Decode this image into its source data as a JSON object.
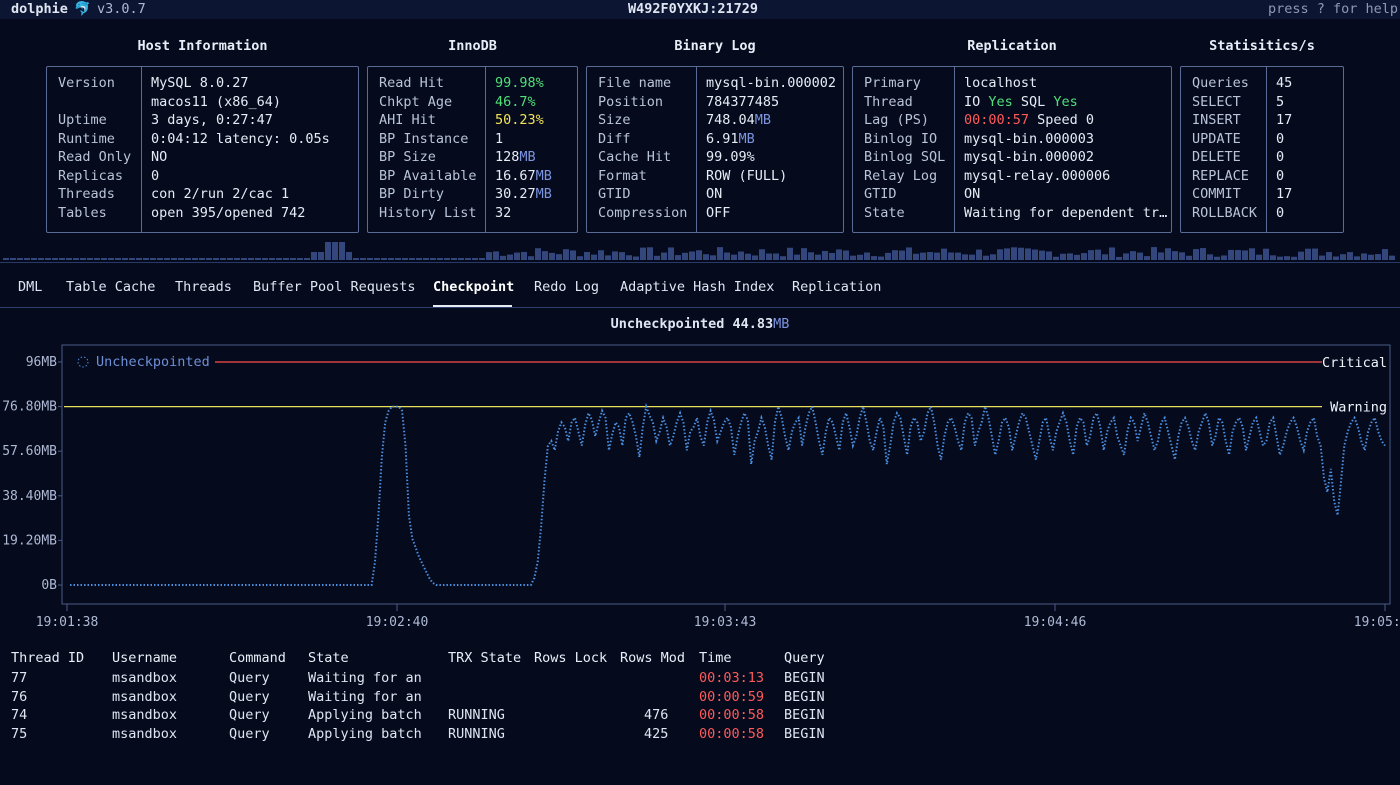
{
  "app": {
    "name": "dolphie",
    "logo": "🐬",
    "version": "v3.0.7",
    "host": "W492F0YXKJ:21729",
    "help": "press ? for help"
  },
  "panels": {
    "host": {
      "title": "Host Information",
      "rows": [
        {
          "label": "Version",
          "value": "MySQL 8.0.27"
        },
        {
          "label": "",
          "value": "macos11 (x86_64)"
        },
        {
          "label": "Uptime",
          "value": "3 days, 0:27:47"
        },
        {
          "label": "Runtime",
          "value": "0:04:12 latency: 0.05s"
        },
        {
          "label": "Read Only",
          "value": "NO"
        },
        {
          "label": "Replicas",
          "value": "0"
        },
        {
          "label": "Threads",
          "value": "con 2/run 2/cac 1"
        },
        {
          "label": "Tables",
          "value": "open 395/opened 742"
        }
      ]
    },
    "innodb": {
      "title": "InnoDB",
      "rows": [
        {
          "label": "Read Hit",
          "value": "99.98%",
          "color": "#4fe07a"
        },
        {
          "label": "Chkpt Age",
          "value": "46.7%",
          "color": "#4fe07a"
        },
        {
          "label": "AHI Hit",
          "value": "50.23%",
          "color": "#f2e35a"
        },
        {
          "label": "BP Instance",
          "value": "1"
        },
        {
          "label": "BP Size",
          "value": "128",
          "unit": "MB"
        },
        {
          "label": "BP Available",
          "value": "16.67",
          "unit": "MB"
        },
        {
          "label": "BP Dirty",
          "value": "30.27",
          "unit": "MB"
        },
        {
          "label": "History List",
          "value": "32"
        }
      ]
    },
    "binlog": {
      "title": "Binary Log",
      "rows": [
        {
          "label": "File name",
          "value": "mysql-bin.000002"
        },
        {
          "label": "Position",
          "value": "784377485"
        },
        {
          "label": "Size",
          "value": "748.04",
          "unit": "MB"
        },
        {
          "label": "Diff",
          "value": "6.91",
          "unit": "MB"
        },
        {
          "label": "Cache Hit",
          "value": "99.09%"
        },
        {
          "label": "Format",
          "value": "ROW (FULL)"
        },
        {
          "label": "GTID",
          "value": "ON"
        },
        {
          "label": "Compression",
          "value": "OFF"
        }
      ]
    },
    "replication": {
      "title": "Replication",
      "rows": [
        {
          "label": "Primary",
          "value": "localhost"
        },
        {
          "label": "Thread",
          "value": "IO Yes SQL Yes"
        },
        {
          "label": "Lag (PS)",
          "value": "00:00:57 Speed 0"
        },
        {
          "label": "Binlog IO",
          "value": "mysql-bin.000003"
        },
        {
          "label": "Binlog SQL",
          "value": "mysql-bin.000002"
        },
        {
          "label": "Relay Log",
          "value": "mysql-relay.000006"
        },
        {
          "label": "GTID",
          "value": "ON"
        },
        {
          "label": "State",
          "value": "Waiting for dependent tr…"
        }
      ]
    },
    "stats": {
      "title": "Statisitics/s",
      "rows": [
        {
          "label": "Queries",
          "value": "45"
        },
        {
          "label": "SELECT",
          "value": "5"
        },
        {
          "label": "INSERT",
          "value": "17"
        },
        {
          "label": "UPDATE",
          "value": "0"
        },
        {
          "label": "DELETE",
          "value": "0"
        },
        {
          "label": "REPLACE",
          "value": "0"
        },
        {
          "label": "COMMIT",
          "value": "17"
        },
        {
          "label": "ROLLBACK",
          "value": "0"
        }
      ]
    }
  },
  "tabs": [
    {
      "label": "DML"
    },
    {
      "label": "Table Cache"
    },
    {
      "label": "Threads"
    },
    {
      "label": "Buffer Pool Requests"
    },
    {
      "label": "Checkpoint",
      "active": true
    },
    {
      "label": "Redo Log"
    },
    {
      "label": "Adaptive Hash Index"
    },
    {
      "label": "Replication"
    }
  ],
  "checkpoint_header": {
    "label": "Uncheckpointed",
    "value": "44.83",
    "unit": "MB"
  },
  "chart_data": {
    "type": "line",
    "legend": "Uncheckpointed",
    "legend_position": "top-left",
    "y_ticks": [
      "96MB",
      "76.80MB",
      "57.60MB",
      "38.40MB",
      "19.20MB",
      "0B"
    ],
    "ylim": [
      0,
      96
    ],
    "x_ticks": [
      "19:01:38",
      "19:02:40",
      "19:03:43",
      "19:04:46",
      "19:05:49"
    ],
    "thresholds": [
      {
        "name": "Critical",
        "value": 96,
        "color": "#ff4d4d"
      },
      {
        "name": "Warning",
        "value": 76.8,
        "color": "#e9e15a"
      }
    ],
    "series": [
      {
        "name": "Uncheckpointed",
        "color": "#4b8fe0",
        "values": [
          0,
          0,
          0,
          0,
          0,
          0,
          0,
          0,
          0,
          0,
          0,
          0,
          0,
          0,
          0,
          0,
          0,
          0,
          0,
          0,
          0,
          0,
          0,
          0,
          0,
          0,
          0,
          0,
          0,
          0,
          0,
          0,
          0,
          0,
          0,
          0,
          0,
          0,
          0,
          0,
          0,
          0,
          0,
          0,
          0,
          0,
          0,
          0,
          0,
          0,
          0,
          0,
          0,
          0,
          0,
          0,
          0,
          0,
          0,
          0,
          0,
          0,
          0,
          0,
          0,
          0,
          0,
          0,
          0,
          0,
          0,
          0,
          0,
          0,
          0,
          0,
          0,
          0,
          0,
          0,
          0,
          0,
          0,
          0,
          0,
          0,
          0,
          0,
          0,
          0,
          10,
          30,
          55,
          70,
          75,
          76.8,
          76.8,
          76.8,
          75,
          60,
          30,
          20,
          16,
          12,
          9,
          6,
          3,
          1,
          0,
          0,
          0,
          0,
          0,
          0,
          0,
          0,
          0,
          0,
          0,
          0,
          0,
          0,
          0,
          0,
          0,
          0,
          0,
          0,
          0,
          0,
          0,
          0,
          0,
          0,
          0,
          0,
          0,
          3,
          10,
          25,
          45,
          60,
          62,
          58,
          66,
          70,
          68,
          62,
          70,
          72,
          66,
          60,
          69,
          74,
          71,
          64,
          70,
          75,
          72,
          58,
          65,
          70,
          68,
          60,
          72,
          74,
          70,
          64,
          55,
          68,
          76.8,
          73,
          70,
          62,
          66,
          72,
          68,
          60,
          64,
          70,
          74,
          70,
          58,
          66,
          68,
          72,
          64,
          60,
          70,
          75,
          71,
          62,
          66,
          70,
          72,
          68,
          56,
          64,
          70,
          74,
          71,
          52,
          62,
          66,
          72,
          68,
          60,
          54,
          70,
          76.8,
          72,
          64,
          58,
          66,
          70,
          72,
          60,
          68,
          74,
          76.8,
          70,
          62,
          56,
          66,
          72,
          70,
          64,
          58,
          70,
          74,
          68,
          60,
          64,
          72,
          76.8,
          70,
          62,
          58,
          66,
          72,
          68,
          52,
          60,
          70,
          74,
          72,
          64,
          56,
          68,
          72,
          70,
          62,
          66,
          74,
          76.8,
          70,
          60,
          54,
          64,
          70,
          72,
          68,
          62,
          58,
          70,
          74,
          72,
          60,
          66,
          70,
          76.8,
          72,
          64,
          56,
          62,
          70,
          72,
          68,
          58,
          64,
          70,
          74,
          72,
          66,
          60,
          54,
          62,
          70,
          72,
          64,
          58,
          66,
          70,
          74,
          70,
          62,
          56,
          68,
          72,
          70,
          60,
          64,
          72,
          74,
          68,
          58,
          66,
          70,
          72,
          64,
          60,
          56,
          66,
          72,
          70,
          62,
          68,
          74,
          70,
          64,
          58,
          62,
          70,
          72,
          66,
          60,
          54,
          64,
          70,
          72,
          68,
          62,
          58,
          66,
          70,
          74,
          70,
          60,
          64,
          72,
          70,
          62,
          56,
          66,
          70,
          72,
          68,
          58,
          64,
          70,
          72,
          66,
          60,
          62,
          70,
          72,
          64,
          56,
          60,
          66,
          70,
          72,
          68,
          62,
          58,
          66,
          70,
          72,
          64,
          60,
          46,
          40,
          50,
          36,
          30,
          44,
          60,
          66,
          70,
          72,
          68,
          62,
          58,
          66,
          70,
          72,
          66,
          62,
          60
        ]
      }
    ]
  },
  "threads_table": {
    "columns": [
      "Thread ID",
      "Username",
      "Command",
      "State",
      "TRX State",
      "Rows Lock",
      "Rows Mod",
      "Time",
      "Query"
    ],
    "rows": [
      [
        "77",
        "msandbox",
        "Query",
        "Waiting for an",
        "",
        "",
        "",
        "00:03:13",
        "BEGIN"
      ],
      [
        "76",
        "msandbox",
        "Query",
        "Waiting for an",
        "",
        "",
        "",
        "00:00:59",
        "BEGIN"
      ],
      [
        "74",
        "msandbox",
        "Query",
        "Applying batch",
        "RUNNING",
        "",
        "476",
        "00:00:58",
        "BEGIN"
      ],
      [
        "75",
        "msandbox",
        "Query",
        "Applying batch",
        "RUNNING",
        "",
        "425",
        "00:00:58",
        "BEGIN"
      ]
    ]
  },
  "colors": {
    "background": "#050a1c",
    "border": "#5a6c95",
    "accent": "#7b95e0",
    "time_red": "#ff5a5a"
  }
}
